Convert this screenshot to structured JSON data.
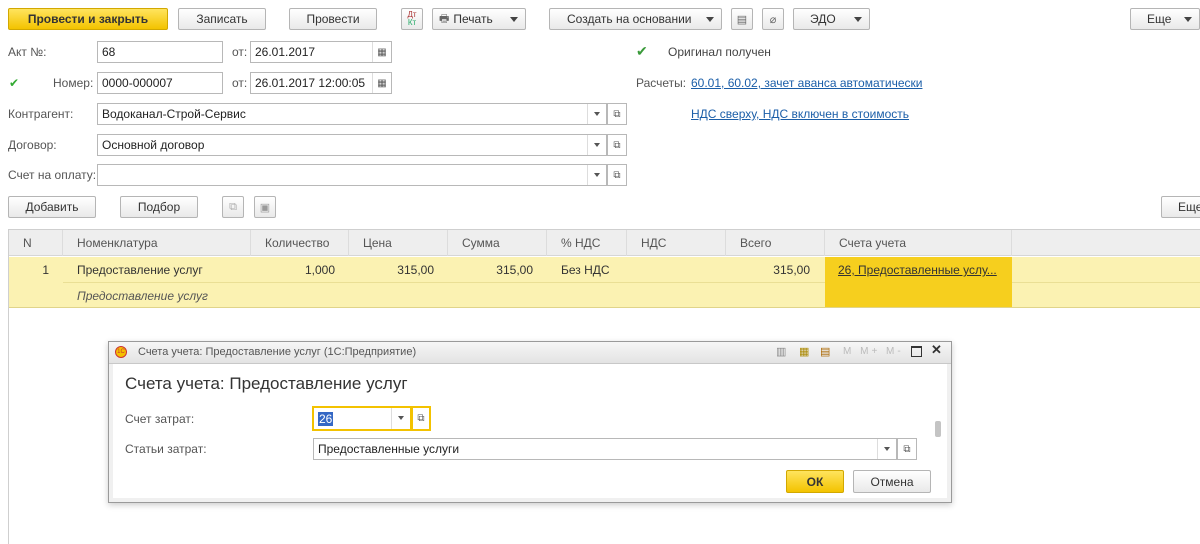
{
  "toolbar": {
    "post_close": "Провести и закрыть",
    "save": "Записать",
    "post": "Провести",
    "print": "Печать",
    "create_based": "Создать на основании",
    "edo": "ЭДО",
    "more": "Еще"
  },
  "header": {
    "act_label": "Акт №:",
    "act_value": "68",
    "from_label": "от:",
    "act_date": "26.01.2017",
    "number_label": "Номер:",
    "number_value": "0000-000007",
    "from_label2": "от:",
    "number_datetime": "26.01.2017 12:00:05",
    "original_received": "Оригинал получен",
    "settlements_label": "Расчеты:",
    "settlements_link": "60.01, 60.02, зачет аванса автоматически",
    "vat_link": "НДС сверху, НДС включен в стоимость",
    "counterparty_label": "Контрагент:",
    "counterparty_value": "Водоканал-Строй-Сервис",
    "contract_label": "Договор:",
    "contract_value": "Основной договор",
    "invoice_label": "Счет на оплату:",
    "invoice_value": ""
  },
  "table_toolbar": {
    "add": "Добавить",
    "pick": "Подбор",
    "more": "Еще"
  },
  "table": {
    "columns": [
      "N",
      "Номенклатура",
      "Количество",
      "Цена",
      "Сумма",
      "% НДС",
      "НДС",
      "Всего",
      "Счета учета"
    ],
    "rows": [
      {
        "n": "1",
        "item": "Предоставление услуг",
        "item_sub": "Предоставление услуг",
        "qty": "1,000",
        "price": "315,00",
        "sum": "315,00",
        "vat_rate": "Без НДС",
        "vat": "",
        "total": "315,00",
        "accounts": "26, Предоставленные услу..."
      }
    ]
  },
  "dialog": {
    "window_title": "Счета учета: Предоставление услуг  (1С:Предприятие)",
    "heading": "Счета учета: Предоставление услуг",
    "cost_account_label": "Счет затрат:",
    "cost_account_value": "26",
    "cost_items_label": "Статьи затрат:",
    "cost_items_value": "Предоставленные услуги",
    "ok": "ОК",
    "cancel": "Отмена"
  }
}
